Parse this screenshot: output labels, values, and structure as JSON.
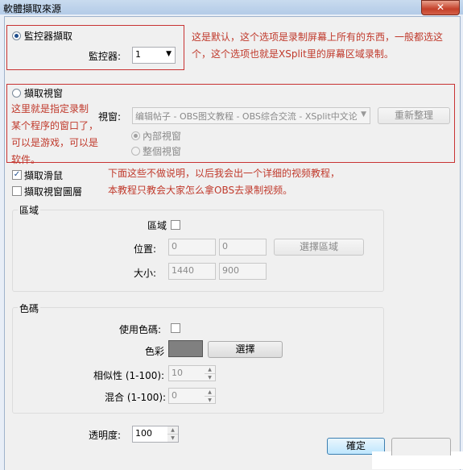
{
  "window": {
    "title": "軟體擷取來源",
    "close": "✕"
  },
  "monitor": {
    "radio_label": "監控器擷取",
    "select_label": "監控器:",
    "select_value": "1",
    "note": [
      "这是默认，这个选项是录制屏幕上所有的东西，一般都选这",
      "个，这个选项也就是XSplit里的屏幕区域录制。"
    ]
  },
  "window_capture": {
    "radio_label": "擷取視窗",
    "note": [
      "这里就是指定录制",
      "某个程序的窗口了，",
      "可以是游戏，可以是软件。"
    ],
    "window_label": "視窗:",
    "window_value": "编辑帖子 - OBS图文教程 - OBS综合交流 - XSplit中文论",
    "refresh_label": "重新整理",
    "inner_label": "內部視窗",
    "whole_label": "整個視窗"
  },
  "options": {
    "mouse_label": "擷取滑鼠",
    "layered_label": "擷取視窗圖層",
    "note": [
      "下面这些不做说明，以后我会出一个详细的视频教程，",
      "本教程只教会大家怎么拿OBS去录制视频。"
    ]
  },
  "region": {
    "group_title": "區域",
    "region_label": "區域",
    "position_label": "位置:",
    "pos_x": "0",
    "pos_y": "0",
    "select_region_label": "選擇區域",
    "size_label": "大小:",
    "width": "1440",
    "height": "900"
  },
  "colorkey": {
    "group_title": "色碼",
    "use_label": "使用色碼:",
    "color_label": "色彩",
    "color_value": "#808080",
    "select_label": "選擇",
    "similarity_label": "相似性 (1-100):",
    "similarity_value": "10",
    "blend_label": "混合 (1-100):",
    "blend_value": "0"
  },
  "opacity": {
    "label": "透明度:",
    "value": "100"
  },
  "footer": {
    "ok_label": "確定"
  }
}
